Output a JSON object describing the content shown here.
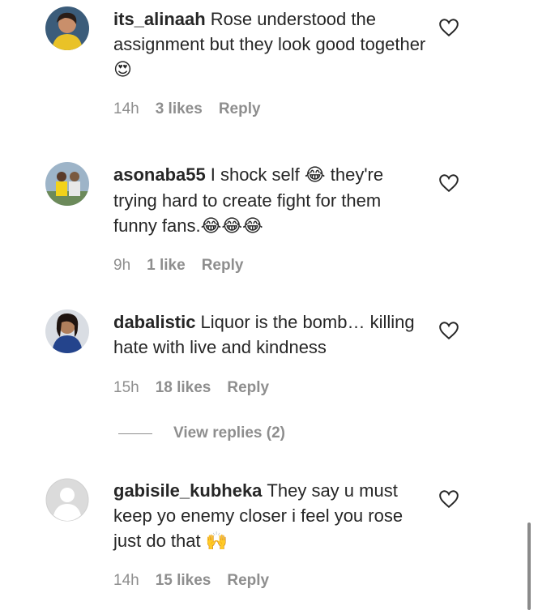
{
  "comments": [
    {
      "username": "its_alinaah",
      "text": "Rose understood the assignment but they look good together",
      "emoji": "😍",
      "time": "14h",
      "likes": "3 likes",
      "reply": "Reply"
    },
    {
      "username": "asonaba55",
      "text_before": "I shock self",
      "emoji_mid": "😂",
      "text_after": "they're trying hard to create fight for them funny fans.",
      "emoji_end": "😂😂😂",
      "time": "9h",
      "likes": "1 like",
      "reply": "Reply"
    },
    {
      "username": "dabalistic",
      "text": "Liquor is the bomb… killing hate with live and kindness",
      "time": "15h",
      "likes": "18 likes",
      "reply": "Reply"
    },
    {
      "username": "gabisile_kubheka",
      "text": "They say u must keep yo enemy closer i feel you rose just do that",
      "emoji": "🙌",
      "time": "14h",
      "likes": "15 likes",
      "reply": "Reply"
    }
  ],
  "view_replies": {
    "label": "View replies (2)"
  },
  "icons": {
    "like": "heart-outline-icon"
  },
  "colors": {
    "text": "#262626",
    "secondary": "#8e8e8e"
  }
}
